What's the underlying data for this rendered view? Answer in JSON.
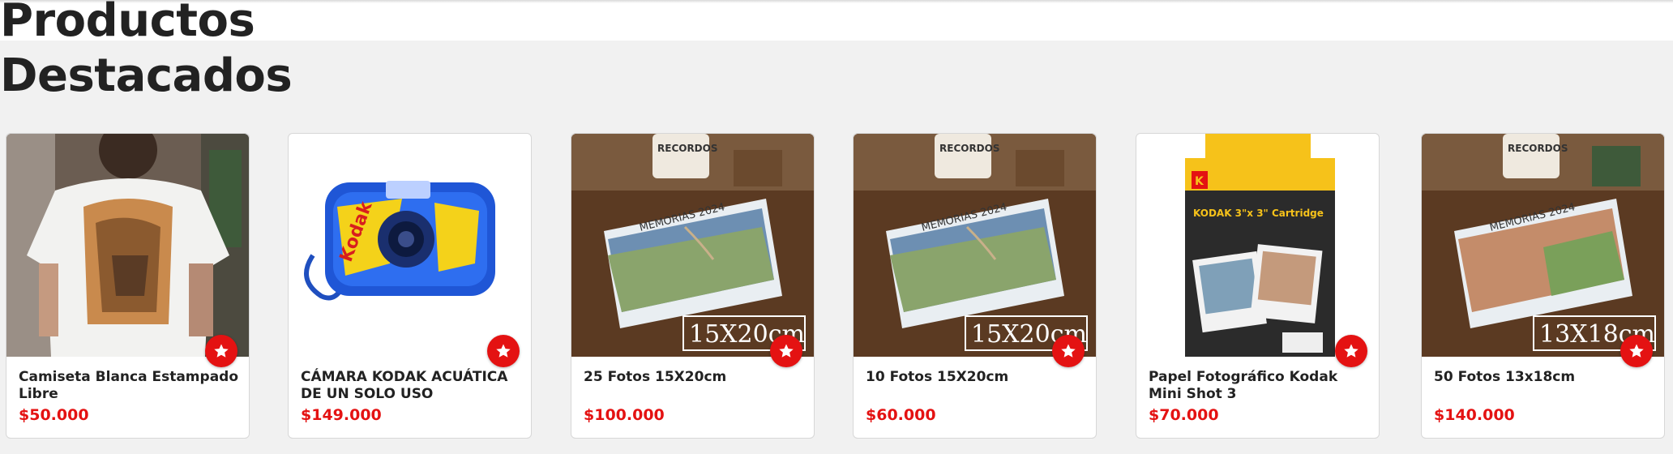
{
  "section": {
    "title_line1": "Productos",
    "title_line2": "Destacados"
  },
  "colors": {
    "accent": "#e41212",
    "page_background": "#f1f1f1",
    "card_background": "#ffffff"
  },
  "products": [
    {
      "name": "Camiseta Blanca Estampado Libre",
      "price": "$50.000",
      "image": "white-printed-tshirt",
      "fav_icon": "star-icon"
    },
    {
      "name": "CÁMARA KODAK ACUÁTICA DE UN SOLO USO",
      "price": "$149.000",
      "image": "kodak-waterproof-disposable-camera",
      "camera_brand": "Kodak",
      "fav_icon": "star-icon"
    },
    {
      "name": "25 Fotos 15X20cm",
      "price": "$100.000",
      "image": "photo-stack-memorias",
      "size_label": "15X20cm",
      "album_label": "MEMORIAS 2024",
      "mug_text": "RECORDOS",
      "fav_icon": "star-icon"
    },
    {
      "name": "10 Fotos 15X20cm",
      "price": "$60.000",
      "image": "photo-stack-memorias",
      "size_label": "15X20cm",
      "album_label": "MEMORIAS 2024",
      "mug_text": "RECORDOS",
      "fav_icon": "star-icon"
    },
    {
      "name": "Papel Fotográfico Kodak Mini Shot 3",
      "price": "$70.000",
      "image": "kodak-cartridge-box",
      "box_title": "KODAK 3\"x 3\" Cartridge",
      "box_brand_mark": "K",
      "fav_icon": "star-icon"
    },
    {
      "name": "50 Fotos 13x18cm",
      "price": "$140.000",
      "image": "photo-stack-memorias",
      "size_label": "13X18cm",
      "album_label": "MEMORIAS 2024",
      "mug_text": "RECORDOS",
      "fav_icon": "star-icon"
    }
  ]
}
